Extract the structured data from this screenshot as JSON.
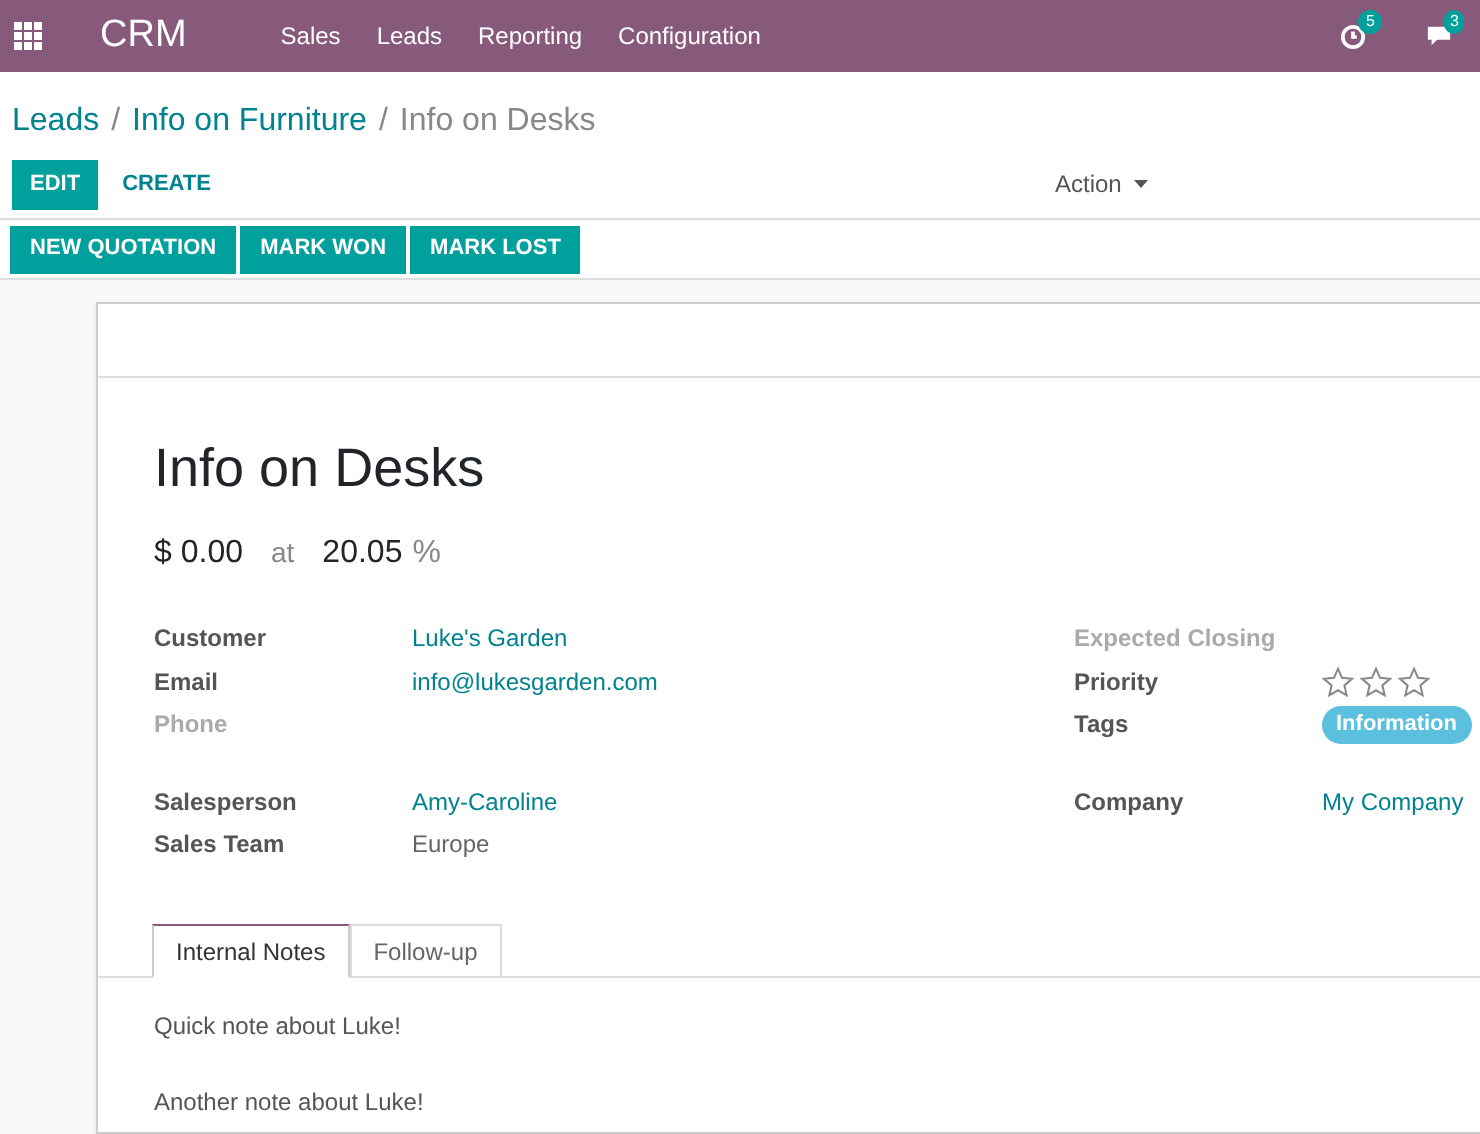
{
  "navbar": {
    "app": "CRM",
    "menu": [
      "Sales",
      "Leads",
      "Reporting",
      "Configuration"
    ],
    "activity_count": "5",
    "message_count": "3"
  },
  "breadcrumb_separator": "/",
  "breadcrumb": [
    {
      "label": "Leads",
      "link": true
    },
    {
      "label": "Info on Furniture",
      "link": true
    },
    {
      "label": "Info on Desks",
      "link": false
    }
  ],
  "buttons": [
    "EDIT",
    "CREATE"
  ],
  "action": "Action",
  "status_buttons": [
    "NEW QUOTATION",
    "MARK WON",
    "MARK LOST"
  ],
  "title": "Info on Desks",
  "revenue": "$ 0.00",
  "at": "at",
  "probability": "20.05",
  "percent": "%",
  "left_groups": [
    [
      {
        "label": "Customer",
        "kind": "link",
        "value": "Luke's Garden"
      },
      {
        "label": "Email",
        "kind": "link",
        "value": "info@lukesgarden.com"
      },
      {
        "label": "Phone",
        "kind": "empty"
      }
    ],
    [
      {
        "label": "Salesperson",
        "kind": "link",
        "value": "Amy-Caroline"
      },
      {
        "label": "Sales Team",
        "kind": "text",
        "value": "Europe"
      }
    ]
  ],
  "right_groups": [
    [
      {
        "label": "Expected Closing",
        "kind": "empty"
      },
      {
        "label": "Priority",
        "kind": "stars",
        "stars": 0
      },
      {
        "label": "Tags",
        "kind": "tag",
        "value": "Information",
        "color": "#5bc0de"
      }
    ],
    [
      {
        "label": "Company",
        "kind": "link",
        "value": "My Company"
      }
    ]
  ],
  "tabs": [
    {
      "label": "Internal Notes",
      "selected": true
    },
    {
      "label": "Follow-up",
      "selected": false
    }
  ],
  "notes": [
    "Quick note about Luke!",
    "Another note about Luke!"
  ]
}
